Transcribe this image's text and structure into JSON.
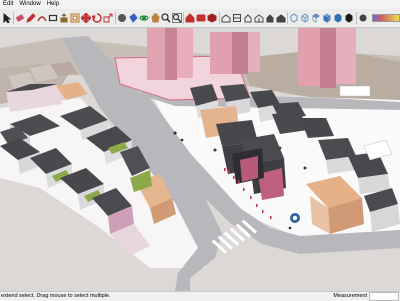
{
  "menu": {
    "items": [
      "Edit",
      "Window",
      "Help"
    ]
  },
  "toolbar": {
    "tools": [
      {
        "name": "select-tool",
        "icon": "arrow-icon",
        "color": "#222222"
      },
      {
        "name": "eraser-tool",
        "icon": "eraser-icon",
        "color": "#d04a6a"
      },
      {
        "name": "line-tool",
        "icon": "pencil-icon",
        "color": "#c03030"
      },
      {
        "name": "arc-tool",
        "icon": "arc-icon",
        "color": "#b03030"
      },
      {
        "name": "rectangle-tool",
        "icon": "rectangle-icon",
        "color": "#333333"
      },
      {
        "name": "pushpull-tool",
        "icon": "pushpull-icon",
        "color": "#8a6a2a"
      },
      {
        "name": "offset-tool",
        "icon": "offset-icon",
        "color": "#c07020"
      },
      {
        "name": "move-tool",
        "icon": "move-icon",
        "color": "#c03030"
      },
      {
        "name": "rotate-tool",
        "icon": "rotate-icon",
        "color": "#c03030"
      },
      {
        "name": "scale-tool",
        "icon": "scale-icon",
        "color": "#c03030"
      },
      {
        "name": "tape-tool",
        "icon": "tape-icon",
        "color": "#555555"
      },
      {
        "name": "paint-tool",
        "icon": "paint-bucket-icon",
        "color": "#3060c0"
      },
      {
        "name": "orbit-tool",
        "icon": "orbit-icon",
        "color": "#2a8a3a"
      },
      {
        "name": "pan-tool",
        "icon": "hand-icon",
        "color": "#c08040"
      },
      {
        "name": "zoom-tool",
        "icon": "magnifier-icon",
        "color": "#333333"
      },
      {
        "name": "zoom-extents-tool",
        "icon": "zoom-extents-icon",
        "color": "#333333"
      },
      {
        "name": "warehouse-tool",
        "icon": "warehouse-icon",
        "color": "#c03030"
      },
      {
        "name": "extension-tool",
        "icon": "extension-icon",
        "color": "#c03030"
      },
      {
        "name": "component-tool",
        "icon": "component-icon",
        "color": "#a02020"
      },
      {
        "name": "iso-view",
        "icon": "house-iso-icon",
        "color": "#444444"
      },
      {
        "name": "top-view",
        "icon": "house-top-icon",
        "color": "#444444"
      },
      {
        "name": "front-view",
        "icon": "house-front-icon",
        "color": "#444444"
      },
      {
        "name": "right-view",
        "icon": "house-right-icon",
        "color": "#444444"
      },
      {
        "name": "back-view",
        "icon": "house-back-icon",
        "color": "#444444"
      },
      {
        "name": "left-view",
        "icon": "house-left-icon",
        "color": "#444444"
      },
      {
        "name": "xray-style",
        "icon": "xray-cube-icon",
        "color": "#6090c0"
      },
      {
        "name": "wireframe-style",
        "icon": "wireframe-cube-icon",
        "color": "#6090c0"
      },
      {
        "name": "hidden-line-style",
        "icon": "hidden-cube-icon",
        "color": "#6090c0"
      },
      {
        "name": "shaded-style",
        "icon": "shaded-cube-icon",
        "color": "#3070b0"
      },
      {
        "name": "textured-style",
        "icon": "textured-cube-icon",
        "color": "#3070b0"
      },
      {
        "name": "monochrome-style",
        "icon": "mono-cube-icon",
        "color": "#1a1a1a"
      },
      {
        "name": "shadow-toggle",
        "icon": "sun-shadow-icon",
        "color": "#444444"
      }
    ],
    "shadow_slider_colors": [
      "#6a6ad0",
      "#d06060",
      "#e0a050",
      "#f0e060"
    ]
  },
  "status": {
    "hint": "extend select. Drag mouse to select multiple.",
    "measure_label": "Measurement"
  },
  "colors": {
    "sky": "#dcd8d6",
    "road": "#b9b9bd",
    "ground": "#ffffff",
    "tower": "#e0a1ad",
    "roof": "#4a4a4e",
    "wall": "#dcdde0",
    "orange_block": "#e3b690",
    "pink_block": "#cf8fb0",
    "green_strip": "#8fa84a"
  }
}
